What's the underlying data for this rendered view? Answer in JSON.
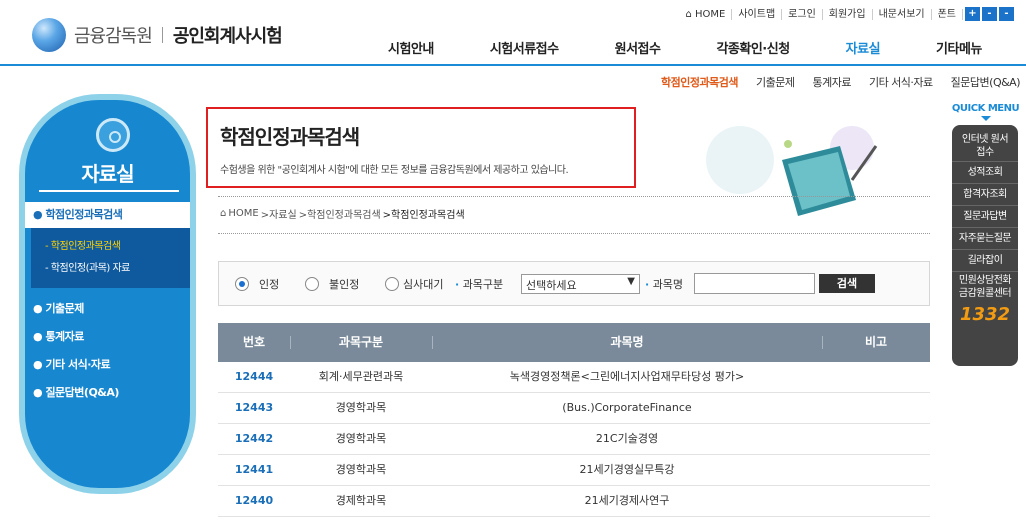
{
  "header": {
    "org": "금융감독원",
    "site": "공인회계사시험",
    "util": [
      "HOME",
      "사이트맵",
      "로그인",
      "회원가입",
      "내문서보기",
      "폰트"
    ],
    "font_buttons": [
      "+",
      "-",
      "-"
    ],
    "gnb": [
      "시험안내",
      "시험서류접수",
      "원서접수",
      "각종확인·신청",
      "자료실",
      "기타메뉴"
    ],
    "sub": [
      "학점인정과목검색",
      "기출문제",
      "통계자료",
      "기타 서식·자료",
      "질문답변(Q&A)"
    ],
    "accent": "#1a8bd6"
  },
  "sidebar": {
    "title": "자료실",
    "active": "학점인정과목검색",
    "sub_items": [
      "학점인정과목검색",
      "학점인정(과목) 자료"
    ],
    "items": [
      "기출문제",
      "통계자료",
      "기타 서식·자료",
      "질문답변(Q&A)"
    ]
  },
  "page": {
    "title": "학점인정과목검색",
    "desc": "수험생을 위한 \"공인회계사 시험\"에 대한 모든 정보를 금융감독원에서 제공하고 있습니다.",
    "breadcrumb": [
      "HOME",
      ">자료실",
      ">학점인정과목검색",
      ">학점인정과목검색"
    ]
  },
  "search": {
    "radios": [
      "인정",
      "불인정",
      "심사대기"
    ],
    "category_label": "과목구분",
    "category_value": "선택하세요",
    "name_label": "과목명",
    "name_value": "",
    "button": "검색"
  },
  "table": {
    "headers": [
      "번호",
      "과목구분",
      "과목명",
      "비고"
    ],
    "rows": [
      [
        "12444",
        "회계·세무관련과목",
        "녹색경영정책론<그린에너지사업재무타당성 평가>",
        ""
      ],
      [
        "12443",
        "경영학과목",
        "(Bus.)CorporateFinance",
        ""
      ],
      [
        "12442",
        "경영학과목",
        "21C기술경영",
        ""
      ],
      [
        "12441",
        "경영학과목",
        "21세기경영실무특강",
        ""
      ],
      [
        "12440",
        "경제학과목",
        "21세기경제사연구",
        ""
      ]
    ]
  },
  "quick_menu": {
    "title": "QUICK MENU",
    "items": [
      "인터넷 원서접수",
      "성적조회",
      "합격자조회",
      "질문과답변",
      "자주묻는질문",
      "길라잡이",
      "민원상담전화 금감원콜센터"
    ],
    "phone": "1332"
  }
}
